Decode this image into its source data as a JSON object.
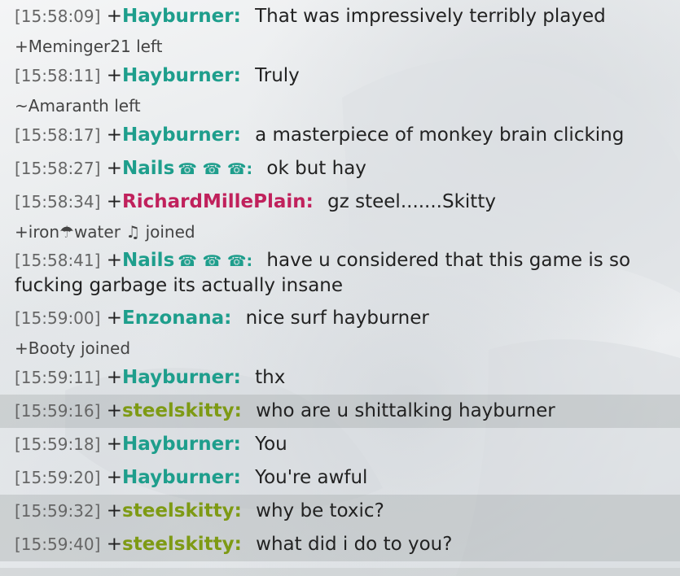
{
  "colors": {
    "teal_user": "#1e9e8c",
    "red_user": "#c0215c",
    "olive_user": "#7e9a14",
    "highlight_row": "#c8cccb"
  },
  "log": {
    "lines": [
      {
        "type": "msg",
        "ts": "[15:58:09]",
        "prefix": "+",
        "user": "Hayburner:",
        "text": "That was impressively terribly played"
      },
      {
        "type": "event",
        "text": "+Meminger21 left"
      },
      {
        "type": "msg",
        "ts": "[15:58:11]",
        "prefix": "+",
        "user": "Hayburner:",
        "text": "Truly"
      },
      {
        "type": "event",
        "text": "~Amaranth left"
      },
      {
        "type": "msg",
        "ts": "[15:58:17]",
        "prefix": "+",
        "user": "Hayburner:",
        "text": "a masterpiece of monkey brain clicking"
      },
      {
        "type": "msg",
        "ts": "[15:58:27]",
        "prefix": "+",
        "user": "Nails",
        "icons": "☎ ☎ ☎:",
        "text": "ok but hay"
      },
      {
        "type": "msg",
        "ts": "[15:58:34]",
        "prefix": "+",
        "user": "RichardMillePlain:",
        "text": "gz steel.......Skitty"
      },
      {
        "type": "event",
        "text": "+iron☂water ♫ joined"
      },
      {
        "type": "msg",
        "ts": "[15:58:41]",
        "prefix": "+",
        "user": "Nails",
        "icons": "☎ ☎ ☎:",
        "text": "have u considered that this game is so fucking garbage its actually insane"
      },
      {
        "type": "msg",
        "ts": "[15:59:00]",
        "prefix": "+",
        "user": "Enzonana:",
        "text": "nice surf hayburner"
      },
      {
        "type": "event",
        "text": "+Booty joined"
      },
      {
        "type": "msg",
        "ts": "[15:59:11]",
        "prefix": "+",
        "user": "Hayburner:",
        "text": "thx"
      },
      {
        "type": "msg",
        "ts": "[15:59:16]",
        "prefix": "+",
        "user": "steelskitty:",
        "text": "who are u shittalking hayburner"
      },
      {
        "type": "msg",
        "ts": "[15:59:18]",
        "prefix": "+",
        "user": "Hayburner:",
        "text": "You"
      },
      {
        "type": "msg",
        "ts": "[15:59:20]",
        "prefix": "+",
        "user": "Hayburner:",
        "text": "You're awful"
      },
      {
        "type": "msg",
        "ts": "[15:59:32]",
        "prefix": "+",
        "user": "steelskitty:",
        "text": "why be toxic?"
      },
      {
        "type": "msg",
        "ts": "[15:59:40]",
        "prefix": "+",
        "user": "steelskitty:",
        "text": "what did i do to you?"
      }
    ]
  }
}
